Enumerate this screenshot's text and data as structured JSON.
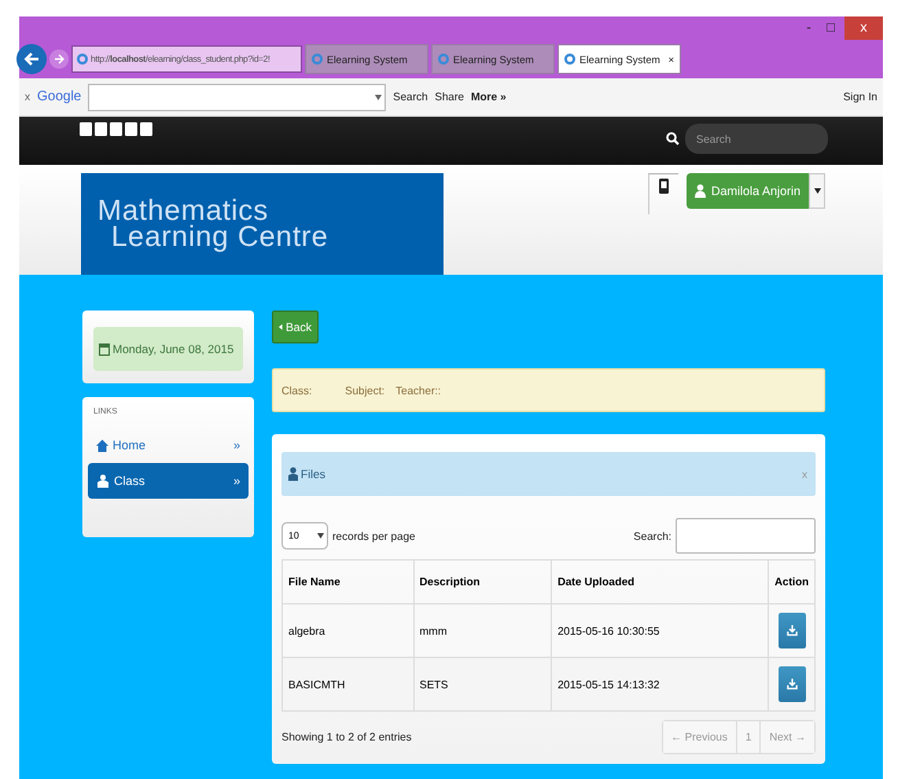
{
  "browser": {
    "window_buttons": [
      "-",
      "□",
      "x"
    ],
    "address": {
      "prefix": "http://",
      "host": "localhost",
      "path": "/elearning/class_student.php?id=2!"
    },
    "tabs": [
      {
        "label": "Elearning System",
        "selected": false
      },
      {
        "label": "Elearning System",
        "selected": false
      },
      {
        "label": "Elearning System",
        "selected": true,
        "close": "×"
      }
    ],
    "google_bar": {
      "close": "x",
      "logo": "Google",
      "search": "Search",
      "share": "Share",
      "more": "More »",
      "sign_in": "Sign In"
    }
  },
  "topbar": {
    "search": {
      "placeholder": "Search"
    }
  },
  "header": {
    "logo_line1": "Mathematics",
    "logo_line2": "Learning Centre",
    "user": "Damilola Anjorin"
  },
  "sidebar": {
    "date": "Monday, June 08, 2015",
    "links_title": "LINKS",
    "items": [
      {
        "label": "Home",
        "kind": "home",
        "selected": false,
        "chevron": "»"
      },
      {
        "label": "Class",
        "kind": "group",
        "selected": true,
        "chevron": "»"
      }
    ]
  },
  "back_button": "Back",
  "info": {
    "class": "Class:",
    "subject": "Subject:",
    "teacher": "Teacher::"
  },
  "files": {
    "title": "Files",
    "close": "x",
    "page_size": "10",
    "page_size_label": "records per page",
    "search_label": "Search:",
    "columns": [
      "File Name",
      "Description",
      "Date Uploaded",
      "Action"
    ],
    "rows": [
      {
        "name": "algebra",
        "description": "mmm",
        "date": "2015-05-16 10:30:55"
      },
      {
        "name": "BASICMTH",
        "description": "SETS",
        "date": "2015-05-15 14:13:32"
      }
    ],
    "summary": "Showing 1 to 2 of 2 entries",
    "pagination": [
      "← Previous",
      "1",
      "Next →"
    ]
  }
}
